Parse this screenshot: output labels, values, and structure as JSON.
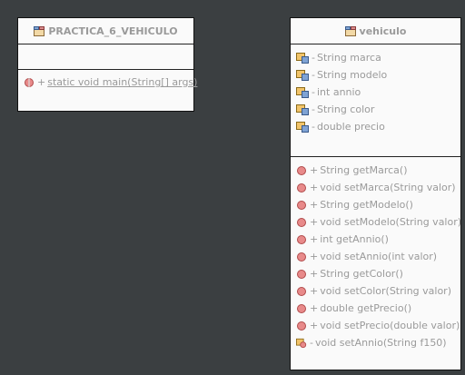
{
  "classes": {
    "main": {
      "name": "PRACTICA_6_VEHICULO",
      "methods": [
        {
          "visibility": "+",
          "text": "static void main(String[] args)"
        }
      ]
    },
    "vehiculo": {
      "name": "vehiculo",
      "fields": [
        {
          "visibility": "-",
          "text": "String marca"
        },
        {
          "visibility": "-",
          "text": "String modelo"
        },
        {
          "visibility": "-",
          "text": "int annio"
        },
        {
          "visibility": "-",
          "text": "String color"
        },
        {
          "visibility": "-",
          "text": "double precio"
        }
      ],
      "methods": [
        {
          "visibility": "+",
          "text": "String getMarca()"
        },
        {
          "visibility": "+",
          "text": "void setMarca(String valor)"
        },
        {
          "visibility": "+",
          "text": "String getModelo()"
        },
        {
          "visibility": "+",
          "text": "void setModelo(String valor)"
        },
        {
          "visibility": "+",
          "text": "int getAnnio()"
        },
        {
          "visibility": "+",
          "text": "void setAnnio(int valor)"
        },
        {
          "visibility": "+",
          "text": "String getColor()"
        },
        {
          "visibility": "+",
          "text": "void setColor(String valor)"
        },
        {
          "visibility": "+",
          "text": "double getPrecio()"
        },
        {
          "visibility": "+",
          "text": "void setPrecio(double valor)"
        },
        {
          "visibility": "-",
          "text": "void setAnnio(String f150)"
        }
      ]
    }
  },
  "icons": {
    "class": "class-icon",
    "field": "field-icon",
    "method": "method-icon",
    "private_method": "private-method-icon"
  }
}
